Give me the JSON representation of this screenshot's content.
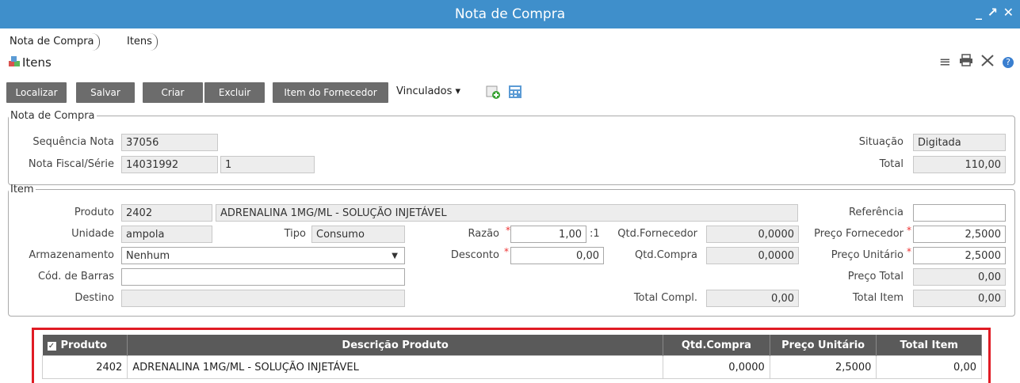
{
  "window": {
    "title": "Nota de Compra",
    "min": "_",
    "max": "↗",
    "close": "✕"
  },
  "breadcrumb": [
    "Nota de Compra",
    "Itens"
  ],
  "page": {
    "title": "Itens"
  },
  "toolbar": {
    "localizar": "Localizar",
    "salvar": "Salvar",
    "criar": "Criar",
    "excluir": "Excluir",
    "item_fornecedor": "Item do Fornecedor",
    "vinculados": "Vinculados ▾"
  },
  "nota": {
    "legend": "Nota de Compra",
    "seq_label": "Sequência Nota",
    "seq": "37056",
    "nf_label": "Nota Fiscal/Série",
    "nf": "14031992",
    "serie": "1",
    "sit_label": "Situação",
    "sit": "Digitada",
    "total_label": "Total",
    "total": "110,00"
  },
  "item": {
    "legend": "Item",
    "produto_label": "Produto",
    "produto_cod": "2402",
    "produto_desc": "ADRENALINA 1MG/ML - SOLUÇÃO INJETÁVEL",
    "ref_label": "Referência",
    "ref": "",
    "unidade_label": "Unidade",
    "unidade": "ampola",
    "tipo_label": "Tipo",
    "tipo": "Consumo",
    "razao_label": "Razão",
    "razao": "1,00",
    "razao_suffix": ":1",
    "qtd_forn_label": "Qtd.Fornecedor",
    "qtd_forn": "0,0000",
    "preco_forn_label": "Preço Fornecedor",
    "preco_forn": "2,5000",
    "arm_label": "Armazenamento",
    "arm": "Nenhum",
    "desc_label": "Desconto",
    "desc": "0,00",
    "qtd_compra_label": "Qtd.Compra",
    "qtd_compra": "0,0000",
    "preco_unit_label": "Preço Unitário",
    "preco_unit": "2,5000",
    "cod_barras_label": "Cód. de Barras",
    "cod_barras": "",
    "preco_total_label": "Preço Total",
    "preco_total": "0,00",
    "destino_label": "Destino",
    "destino": "",
    "total_compl_label": "Total Compl.",
    "total_compl": "0,00",
    "total_item_label": "Total Item",
    "total_item": "0,00"
  },
  "grid": {
    "headers": [
      "Produto",
      "Descrição Produto",
      "Qtd.Compra",
      "Preço Unitário",
      "Total Item"
    ],
    "rows": [
      [
        "2402",
        "ADRENALINA 1MG/ML - SOLUÇÃO INJETÁVEL",
        "0,0000",
        "2,5000",
        "0,00"
      ]
    ]
  },
  "colors": {
    "titlebar": "#3f8fcb",
    "button": "#6c6c6c",
    "highlight": "#e01b24",
    "grid_header": "#5a5a5a"
  },
  "icons": [
    "menu-icon",
    "print-icon",
    "tools-icon",
    "help-icon",
    "add-item-icon",
    "calculator-icon",
    "cubes-icon"
  ]
}
